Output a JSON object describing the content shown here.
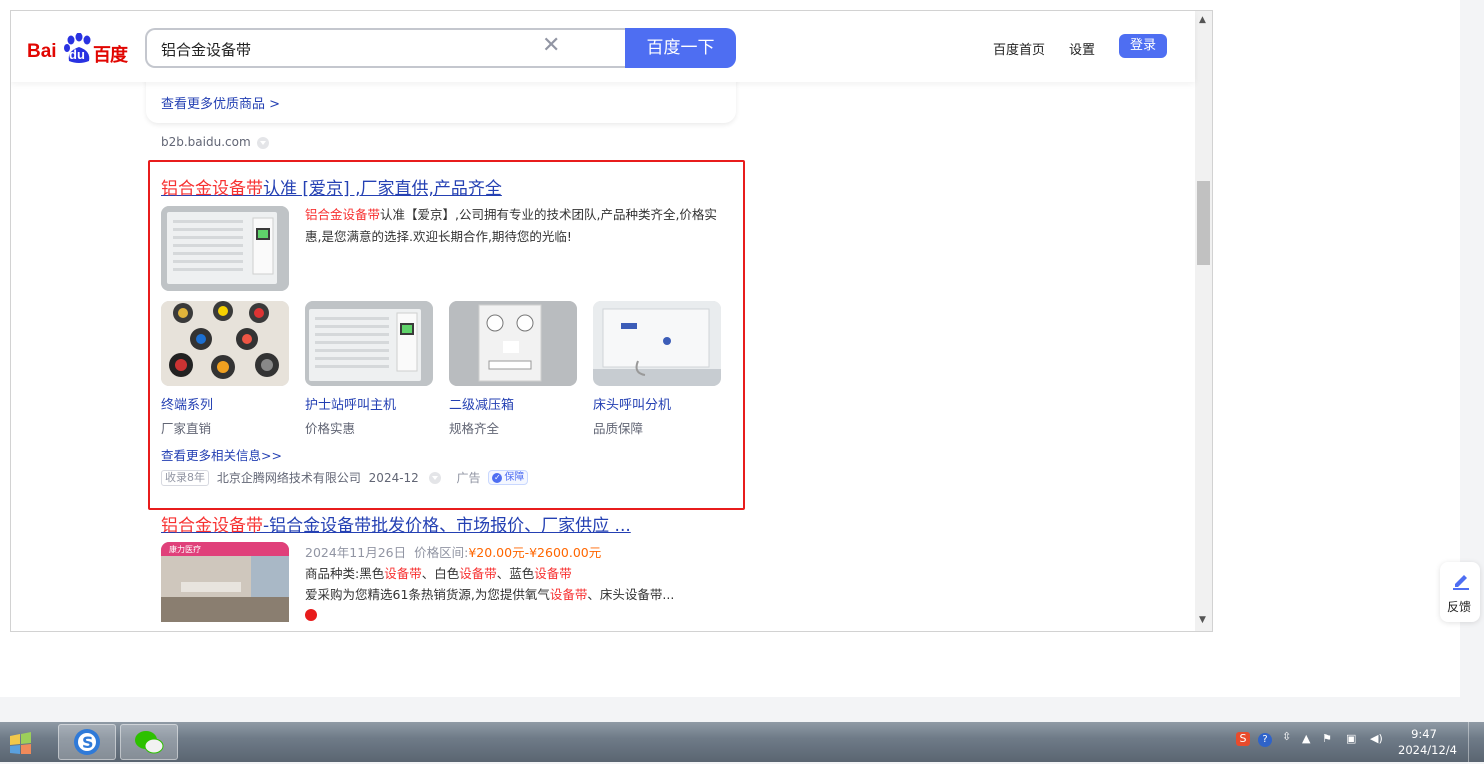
{
  "search": {
    "query": "铝合金设备带",
    "button": "百度一下"
  },
  "logo": {
    "bai": "Bai",
    "du": "du",
    "cn": "百度"
  },
  "header_links": {
    "home": "百度首页",
    "settings": "设置",
    "login": "登录"
  },
  "prev_card": {
    "more_goods": "查看更多优质商品 >",
    "site_url": "b2b.baidu.com"
  },
  "ad": {
    "title_highlight": "铝合金设备带",
    "title_rest": "认准 [爱京] ,厂家直供,产品齐全",
    "desc_highlight": "铝合金设备带",
    "desc_rest": "认准【爱京】,公司拥有专业的技术团队,产品种类齐全,价格实惠,是您满意的选择.欢迎长期合作,期待您的光临!",
    "categories": [
      {
        "label": "终端系列",
        "sub": "厂家直销"
      },
      {
        "label": "护士站呼叫主机",
        "sub": "价格实惠"
      },
      {
        "label": "二级减压箱",
        "sub": "规格齐全"
      },
      {
        "label": "床头呼叫分机",
        "sub": "品质保障"
      }
    ],
    "more_info": "查看更多相关信息>>",
    "meta": {
      "indexed": "收录8年",
      "company": "北京企腾网络技术有限公司",
      "date": "2024-12",
      "ad_label": "广告",
      "guarantee": "保障"
    },
    "panel_text": "二级减压箱"
  },
  "result2": {
    "title_highlight": "铝合金设备带",
    "title_rest": "-铝合金设备带批发价格、市场报价、厂家供应 ...",
    "thumb_badge": "康力医疗",
    "date": "2024年11月26日",
    "price_label": "价格区间:",
    "price": "¥20.00元-¥2600.00元",
    "line2_prefix": "商品种类:黑色",
    "line2_hl1": "设备带",
    "line2_mid1": "、白色",
    "line2_hl2": "设备带",
    "line2_mid2": "、蓝色",
    "line2_hl3": "设备带",
    "line3_prefix": "爱采购为您精选61条热销货源,为您提供氧气",
    "line3_hl": "设备带",
    "line3_rest": "、床头设备带..."
  },
  "feedback": {
    "label": "反馈"
  },
  "taskbar": {
    "time": "9:47",
    "date": "2024/12/4"
  },
  "colors": {
    "brand_blue": "#4e6ef2",
    "link_blue": "#2440b3",
    "highlight_red": "#f73131",
    "ad_border": "#e81c1c",
    "price_orange": "#ff6600"
  }
}
